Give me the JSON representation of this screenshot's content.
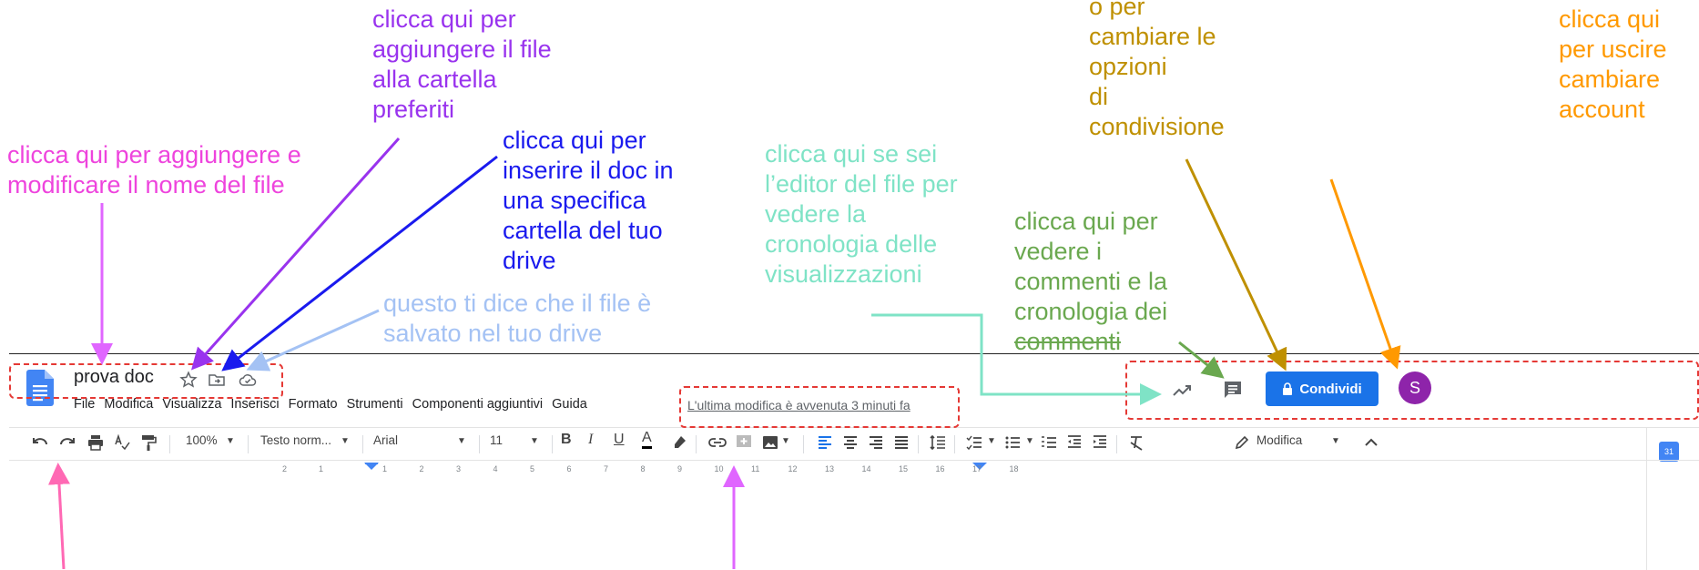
{
  "annotations": {
    "rename": [
      "clicca qui per aggiungere e",
      "modificare il nome del file"
    ],
    "favorite": [
      "clicca qui per",
      "aggiungere il file",
      "alla cartella",
      "preferiti"
    ],
    "move_folder": [
      "clicca qui per",
      "inserire il doc in",
      "una specifica",
      "cartella del tuo",
      "drive"
    ],
    "saved": [
      "questo ti dice che il file è",
      "salvato nel tuo drive"
    ],
    "activity": [
      "clicca qui se sei",
      "l’editor del file per",
      "vedere la",
      "cronologia delle",
      "visualizzazioni"
    ],
    "comments": [
      "clicca qui per",
      "vedere i",
      "commenti e la",
      "cronologia dei",
      "commenti"
    ],
    "share": [
      "o per",
      "cambiare le",
      "opzioni",
      "di",
      "condivisione"
    ],
    "account": [
      "clicca qui",
      "per uscire",
      "cambiare",
      "account"
    ]
  },
  "colors": {
    "rename": "#ee44dd",
    "favorite": "#9933ee",
    "move_folder": "#1a1aee",
    "saved": "#a4c2f4",
    "activity": "#7fe3c6",
    "comments": "#6aa84f",
    "share": "#bf9000",
    "account": "#ff9900",
    "pink_arrow": "#ff69b4",
    "orchid_arrow": "#e066ff",
    "dashed": "#e53935",
    "share_button": "#1a73e8",
    "avatar": "#8e24aa"
  },
  "doc": {
    "title": "prova doc",
    "last_edit": "L'ultima modifica è avvenuta 3 minuti fa"
  },
  "menu": [
    "File",
    "Modifica",
    "Visualizza",
    "Inserisci",
    "Formato",
    "Strumenti",
    "Componenti aggiuntivi",
    "Guida"
  ],
  "header": {
    "share_label": "Condividi",
    "avatar_letter": "S"
  },
  "toolbar": {
    "zoom": "100%",
    "style": "Testo norm...",
    "font": "Arial",
    "size": "11",
    "bold": "B",
    "italic": "I",
    "underline": "U",
    "text_color": "A",
    "mode": "Modifica"
  },
  "ruler": {
    "left": [
      "2",
      "1"
    ],
    "right": [
      "1",
      "2",
      "3",
      "4",
      "5",
      "6",
      "7",
      "8",
      "9",
      "10",
      "11",
      "12",
      "13",
      "14",
      "15",
      "16",
      "17",
      "18"
    ]
  },
  "side": {
    "calendar_day": "31"
  }
}
